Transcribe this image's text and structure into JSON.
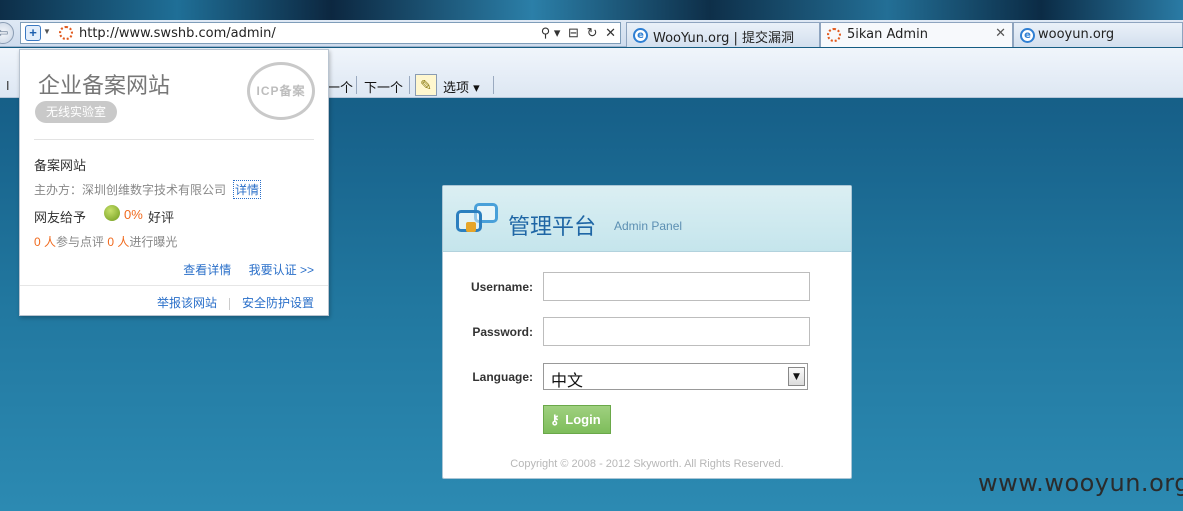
{
  "browser": {
    "url": "http://www.swshb.com/admin/",
    "tabs": [
      {
        "label": "WooYun.org | 提交漏洞"
      },
      {
        "label": "5ikan Admin"
      },
      {
        "label": "wooyun.org"
      }
    ],
    "tab_close": "✕",
    "address_tools": [
      "⚲ ▾",
      "⊟",
      "↻",
      "✕"
    ],
    "nav_back": "⇦",
    "cmd_next_partial": "一个",
    "cmd_next": "下一个",
    "cmd_options": "选项 ▾",
    "cmd_left_partial": "I"
  },
  "icp_popup": {
    "title": "企业备案网站",
    "badge": "无线实验室",
    "seal_text": "ICP备案",
    "site_name": "备案网站",
    "sponsor": "主办方：深圳创维数字技术有限公司",
    "detail_link": "详情",
    "rating_label": "网友给予",
    "rating_percent": "0%",
    "rating_word": "好评",
    "count_review_num": "0 人",
    "count_review_text": "参与点评",
    "count_expose_num": "0 人",
    "count_expose_text": "进行曝光",
    "view_details": "查看详情",
    "verify_link": "我要认证 >>",
    "report_site": "举报该网站",
    "security_settings": "安全防护设置"
  },
  "login": {
    "title": "管理平台",
    "subtitle": "Admin Panel",
    "username_label": "Username:",
    "password_label": "Password:",
    "language_label": "Language:",
    "language_value": "中文",
    "login_button": "Login",
    "copyright": "Copyright © 2008 - 2012 Skyworth. All Rights Reserved."
  },
  "watermark": "www.wooyun.org",
  "colors": {
    "background": "#1b6790",
    "login_header": "#c5e5ec",
    "login_button": "#8cc66b",
    "link": "#2a6fc9",
    "orange": "#f06a1e"
  }
}
